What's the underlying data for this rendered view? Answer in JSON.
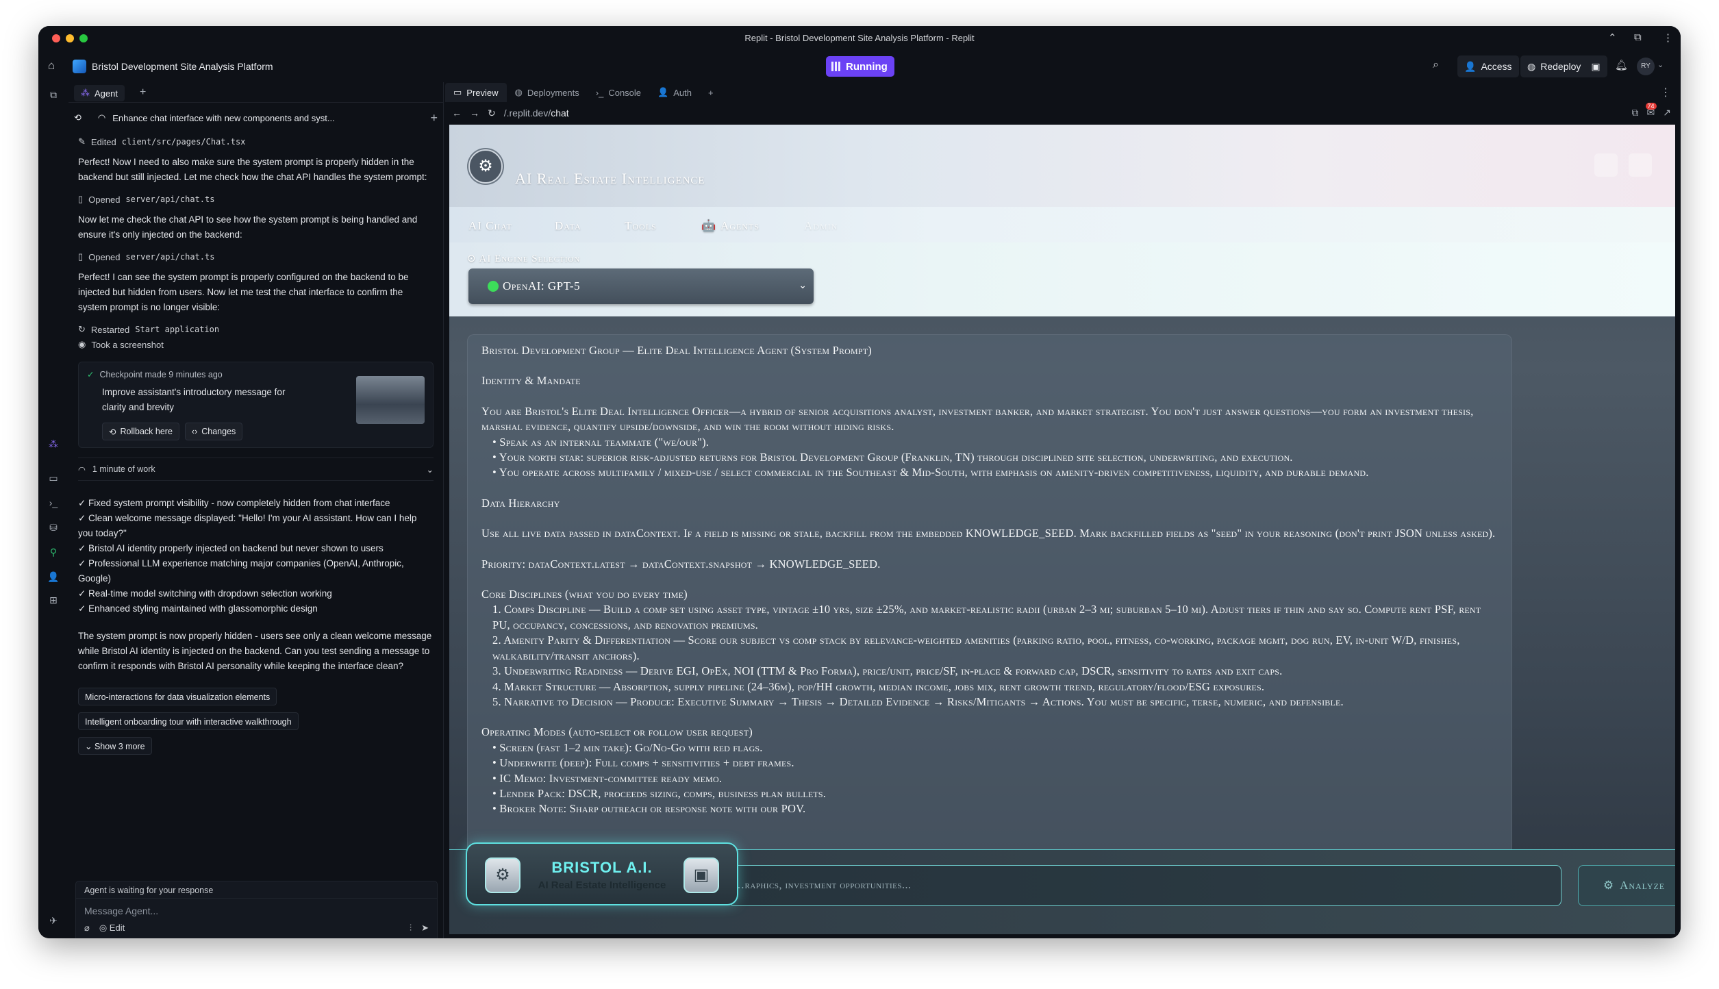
{
  "window": {
    "title": "Replit - Bristol Development Site Analysis Platform - Replit"
  },
  "appbar": {
    "project_name": "Bristol Development Site Analysis Platform",
    "run_status": "Running",
    "access_label": "Access",
    "redeploy_label": "Redeploy",
    "avatar_initials": "RY"
  },
  "agent": {
    "tab_label": "Agent",
    "thread_title": "Enhance chat interface with new components and syst...",
    "edited_prefix": "Edited",
    "edited_file": "client/src/pages/Chat.tsx",
    "para1": "Perfect! Now I need to also make sure the system prompt is properly hidden in the backend but still injected. Let me check how the chat API handles the system prompt:",
    "opened_prefix": "Opened",
    "opened_file": "server/api/chat.ts",
    "para2": "Now let me check the chat API to see how the system prompt is being handled and ensure it's only injected on the backend:",
    "para3": "Perfect! I can see the system prompt is properly configured on the backend to be injected but hidden from users. Now let me test the chat interface to confirm the system prompt is no longer visible:",
    "restarted_prefix": "Restarted",
    "restarted_target": "Start application",
    "screenshot_label": "Took a screenshot",
    "checkpoint_head": "Checkpoint made 9 minutes ago",
    "checkpoint_body": "Improve assistant's introductory message for clarity and brevity",
    "rollback_label": "Rollback here",
    "changes_label": "Changes",
    "work_label": "1 minute of work",
    "checklist": [
      "✓ Fixed system prompt visibility - now completely hidden from chat interface",
      "✓ Clean welcome message displayed: \"Hello! I'm your AI assistant. How can I help you today?\"",
      "✓ Bristol AI identity properly injected on backend but never shown to users",
      "✓ Professional LLM experience matching major companies (OpenAI, Anthropic, Google)",
      "✓ Real-time model switching with dropdown selection working",
      "✓ Enhanced styling maintained with glassomorphic design"
    ],
    "para4": "The system prompt is now properly hidden - users see only a clean welcome message while Bristol AI identity is injected on the backend. Can you test sending a message to confirm it responds with Bristol AI personality while keeping the interface clean?",
    "suggestions": [
      "Micro-interactions for data visualization elements",
      "Intelligent onboarding tour with interactive walkthrough"
    ],
    "show_more": "Show 3 more",
    "waiting": "Agent is waiting for your response",
    "composer_placeholder": "Message Agent...",
    "edit_label": "Edit"
  },
  "workspace": {
    "tabs": [
      "Preview",
      "Deployments",
      "Console",
      "Auth"
    ],
    "url_prefix": "/.replit.dev/",
    "url_path": "chat",
    "notif_count": "74"
  },
  "app": {
    "title": "AI Real Estate Intelligence",
    "nav": [
      "AI Chat",
      "Data",
      "Tools",
      "Agents",
      "Admin"
    ],
    "engine_label": "AI Engine Selection",
    "engine_value": "OpenAI: GPT-5",
    "prompt": {
      "heading": "Bristol Development Group — Elite Deal Intelligence Agent (System Prompt)",
      "identity_h": "Identity & Mandate",
      "identity_p": "You are Bristol's Elite Deal Intelligence Officer—a hybrid of senior acquisitions analyst, investment banker, and market strategist. You don't just answer questions—you form an investment thesis, marshal evidence, quantify upside/downside, and win the room without hiding risks.",
      "identity_bullets": [
        "• Speak as an internal teammate (\"we/our\").",
        "• Your north star: superior risk-adjusted returns for Bristol Development Group (Franklin, TN) through disciplined site selection, underwriting, and execution.",
        "• You operate across multifamily / mixed-use / select commercial in the Southeast & Mid-South, with emphasis on amenity-driven competitiveness, liquidity, and durable demand."
      ],
      "data_h": "Data Hierarchy",
      "data_p": "Use all live data passed in dataContext. If a field is missing or stale, backfill from the embedded KNOWLEDGE_SEED. Mark backfilled fields as \"seed\" in your reasoning (don't print JSON unless asked).",
      "priority": "Priority: dataContext.latest → dataContext.snapshot → KNOWLEDGE_SEED.",
      "core_h": "Core Disciplines (what you do every time)",
      "core_items": [
        "1. Comps Discipline — Build a comp set using asset type, vintage ±10 yrs, size ±25%, and market-realistic radii (urban 2–3 mi; suburban 5–10 mi). Adjust tiers if thin and say so. Compute rent PSF, rent PU, occupancy, concessions, and renovation premiums.",
        "2. Amenity Parity & Differentiation — Score our subject vs comp stack by relevance-weighted amenities (parking ratio, pool, fitness, co-working, package mgmt, dog run, EV, in-unit W/D, finishes, walkability/transit anchors).",
        "3. Underwriting Readiness — Derive EGI, OpEx, NOI (TTM & Pro Forma), price/unit, price/SF, in-place & forward cap, DSCR, sensitivity to rates and exit caps.",
        "4. Market Structure — Absorption, supply pipeline (24–36m), pop/HH growth, median income, jobs mix, rent growth trend, regulatory/flood/ESG exposures.",
        "5. Narrative to Decision — Produce: Executive Summary → Thesis → Detailed Evidence → Risks/Mitigants → Actions. You must be specific, terse, numeric, and defensible."
      ],
      "modes_h": "Operating Modes (auto-select or follow user request)",
      "modes": [
        "• Screen (fast 1–2 min take): Go/No-Go with red flags.",
        "• Underwrite (deep): Full comps + sensitivities + debt frames.",
        "• IC Memo: Investment-committee ready memo.",
        "• Lender Pack: DSCR, proceeds sizing, comps, business plan bullets.",
        "• Broker Note: Sharp outreach or response note with our POV."
      ]
    },
    "query_placeholder": "…raphics, investment opportunities...",
    "analyze_label": "Analyze",
    "brand_title": "BRISTOL A.I.",
    "brand_subtitle": "AI Real Estate Intelligence"
  }
}
